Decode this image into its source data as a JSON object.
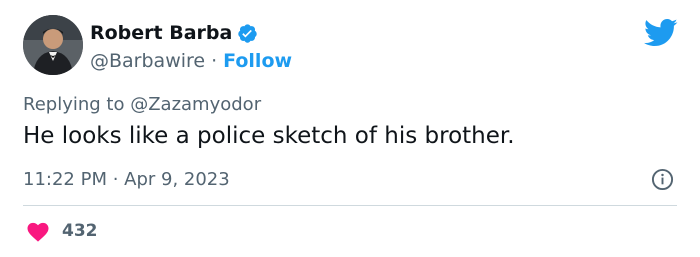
{
  "author": {
    "name": "Robert Barba",
    "handle": "@Barbawire",
    "separator": "·",
    "follow_label": "Follow",
    "verified": true
  },
  "reply": {
    "prefix": "Replying to",
    "to_handle": "@Zazamyodor"
  },
  "tweet": {
    "text": "He looks like a police sketch of his brother.",
    "timestamp": "11:22 PM · Apr 9, 2023"
  },
  "engagement": {
    "like_count": "432"
  },
  "icons": {
    "brand": "twitter-bird-icon",
    "verified": "verified-badge-icon",
    "info": "info-icon",
    "like": "heart-icon"
  },
  "colors": {
    "brand_blue": "#1d9bf0",
    "muted_text": "#536471",
    "main_text": "#0f1419",
    "like_pink": "#f91880",
    "divider": "#cfd9de"
  }
}
